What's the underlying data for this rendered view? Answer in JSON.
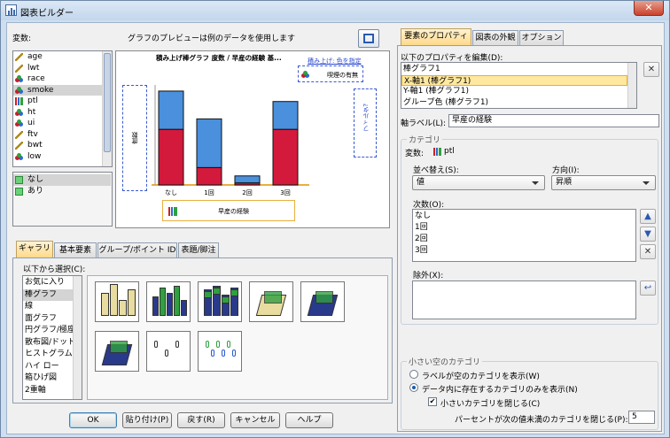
{
  "window": {
    "title": "図表ビルダー"
  },
  "variables": {
    "label": "変数:",
    "items": [
      {
        "name": "age",
        "type": "scale"
      },
      {
        "name": "lwt",
        "type": "scale"
      },
      {
        "name": "race",
        "type": "nominal"
      },
      {
        "name": "smoke",
        "type": "nominal"
      },
      {
        "name": "ptl",
        "type": "ordinal"
      },
      {
        "name": "ht",
        "type": "nominal"
      },
      {
        "name": "ui",
        "type": "nominal"
      },
      {
        "name": "ftv",
        "type": "scale"
      },
      {
        "name": "bwt",
        "type": "scale"
      },
      {
        "name": "low",
        "type": "nominal"
      }
    ],
    "categories": [
      "なし",
      "あり"
    ]
  },
  "preview": {
    "note": "グラフのプレビューは例のデータを使用します",
    "chart_title": "積み上げ棒グラフ 度数 / 早産の経験 基...",
    "stack_label": "積み上げ: 色を指定",
    "stack_legend_item": "喫煙の有無",
    "y_drop_label": "度数",
    "filter_label": "フィルタ?",
    "x_drop_label": "早産の経験",
    "chart_data": {
      "type": "bar",
      "categories": [
        "なし",
        "1回",
        "2回",
        "3回"
      ],
      "series": [
        {
          "values": [
            80,
            25,
            3,
            80
          ]
        },
        {
          "values": [
            55,
            70,
            10,
            40
          ]
        }
      ],
      "colors": [
        "#d41a3c",
        "#4a90dc"
      ]
    }
  },
  "gallery": {
    "tabs": [
      "ギャラリ",
      "基本要素",
      "グループ/ポイント ID",
      "表題/脚注"
    ],
    "choose_label": "以下から選択(C):",
    "types": [
      "お気に入り",
      "棒グラフ",
      "線",
      "面グラフ",
      "円グラフ/極座標",
      "散布図/ドット",
      "ヒストグラム",
      "ハイ ロー",
      "箱ひげ図",
      "2重軸"
    ],
    "selected_type": "棒グラフ",
    "thumbnails": [
      "simple-bar",
      "clustered-bar",
      "stacked-bar",
      "3d-simple-bar",
      "3d-clustered-bar",
      "3d-bar",
      "simple-error-bar",
      "clustered-error-bar"
    ]
  },
  "buttons": {
    "ok": "OK",
    "paste": "貼り付け(P)",
    "reset": "戻す(R)",
    "cancel": "キャンセル",
    "help": "ヘルプ"
  },
  "props": {
    "tabs": [
      "要素のプロパティ",
      "図表の外観",
      "オプション"
    ],
    "edit_label": "以下のプロパティを編集(D):",
    "edit_items": [
      "棒グラフ1",
      "X-軸1 (棒グラフ1)",
      "Y-軸1 (棒グラフ1)",
      "グループ色 (棒グラフ1)"
    ],
    "selected_item": "X-軸1 (棒グラフ1)",
    "axis_label_caption": "軸ラベル(L):",
    "axis_label_value": "早産の経験",
    "category_group": "カテゴリ",
    "variable_caption": "変数:",
    "variable_value": "ptl",
    "sort_caption": "並べ替え(S):",
    "sort_value": "値",
    "direction_caption": "方向(I):",
    "direction_value": "昇順",
    "order_caption": "次数(O):",
    "order_items": [
      "なし",
      "1回",
      "2回",
      "3回"
    ],
    "excluded_caption": "除外(X):",
    "small_group": "小さい空のカテゴリ",
    "radio1": "ラベルが空のカテゴリを表示(W)",
    "radio2": "データ内に存在するカテゴリのみを表示(N)",
    "check1": "小さいカテゴリを閉じる(C)",
    "percent_caption": "パーセントが次の値未満のカテゴリを閉じる(P):",
    "percent_value": "5"
  }
}
